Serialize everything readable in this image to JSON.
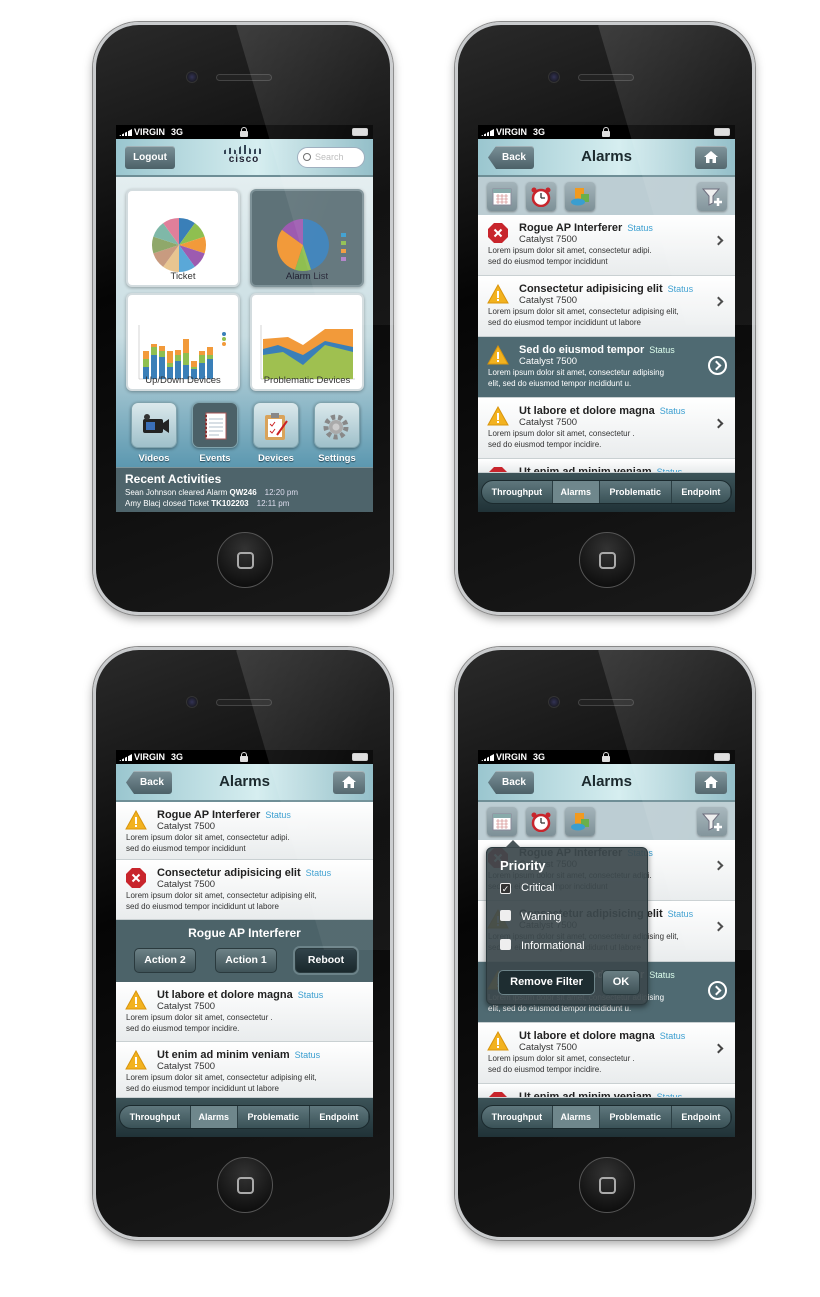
{
  "status_bar": {
    "carrier": "VIRGIN",
    "network": "3G"
  },
  "colors": {
    "accent": "#3a9ed0",
    "nav_dark": "#4e646b",
    "critical": "#c8252c",
    "warning": "#f2b21f"
  },
  "dashboard": {
    "logout_label": "Logout",
    "logo": "cisco",
    "search_placeholder": "Search",
    "tiles": [
      {
        "label": "Ticket",
        "icon": "pie-chart-thumbnail"
      },
      {
        "label": "Alarm List",
        "icon": "pie-chart-legend-thumbnail",
        "selected": true
      },
      {
        "label": "Up/Down Devices",
        "icon": "stacked-bar-chart-thumbnail"
      },
      {
        "label": "Problematic Devices",
        "icon": "area-chart-thumbnail"
      }
    ],
    "apps": [
      {
        "label": "Videos",
        "icon": "video-camera-icon"
      },
      {
        "label": "Events",
        "icon": "notebook-icon",
        "selected": true
      },
      {
        "label": "Devices",
        "icon": "clipboard-icon"
      },
      {
        "label": "Settings",
        "icon": "gear-icon"
      }
    ],
    "recent": {
      "title": "Recent Activities",
      "items": [
        {
          "text": "Sean Johnson cleared Alarm",
          "id": "QW246",
          "time": "12:20 pm"
        },
        {
          "text": "Amy Blacj closed Ticket",
          "id": "TK102203",
          "time": "12:11 pm"
        }
      ]
    }
  },
  "alarms_nav": {
    "back_label": "Back",
    "title": "Alarms",
    "home_icon": "home-icon"
  },
  "toolbar": {
    "icons": [
      "calendar-icon",
      "alarm-clock-icon",
      "devices-icon"
    ],
    "filter_icon": "filter-add-icon"
  },
  "alarm_list": [
    {
      "title": "Rogue AP Interferer",
      "status": "Status",
      "device": "Catalyst 7500",
      "desc": [
        "Lorem ipsum dolor sit amet, consectetur adipi.",
        "sed do eiusmod tempor incididunt"
      ],
      "severity": "critical"
    },
    {
      "title": "Consectetur adipisicing elit",
      "status": "Status",
      "device": "Catalyst 7500",
      "desc": [
        "Lorem ipsum dolor sit amet, consectetur adipising elit,",
        "sed do eiusmod tempor incididunt ut labore"
      ],
      "severity": "warning"
    },
    {
      "title": "Sed do eiusmod tempor",
      "status": "Status",
      "device": "Catalyst 7500",
      "desc": [
        "Lorem ipsum dolor sit amet, consectetur adipising",
        "elit, sed do eiusmod tempor incididunt u."
      ],
      "severity": "warning",
      "selected": true
    },
    {
      "title": "Ut labore et dolore magna",
      "status": "Status",
      "device": "Catalyst 7500",
      "desc": [
        "Lorem ipsum dolor sit amet, consectetur .",
        "sed do eiusmod tempor incidire."
      ],
      "severity": "warning"
    },
    {
      "title": "Ut enim ad minim veniam",
      "status": "Status",
      "device": "",
      "desc": [
        "",
        ""
      ],
      "severity": "critical"
    }
  ],
  "action_list": [
    {
      "title": "Rogue AP Interferer",
      "status": "Status",
      "device": "Catalyst 7500",
      "desc": [
        "Lorem ipsum dolor sit amet, consectetur adipi.",
        "sed do eiusmod tempor incididunt"
      ],
      "severity": "warning"
    },
    {
      "title": "Consectetur adipisicing elit",
      "status": "Status",
      "device": "Catalyst 7500",
      "desc": [
        "Lorem ipsum dolor sit amet, consectetur adipising elit,",
        "sed do eiusmod tempor incididunt ut labore"
      ],
      "severity": "critical"
    },
    {
      "title": "Ut labore et dolore magna",
      "status": "Status",
      "device": "Catalyst 7500",
      "desc": [
        "Lorem ipsum dolor sit amet, consectetur .",
        "sed do eiusmod tempor incidire."
      ],
      "severity": "warning"
    },
    {
      "title": "Ut enim ad minim veniam",
      "status": "Status",
      "device": "Catalyst 7500",
      "desc": [
        "Lorem ipsum dolor sit amet, consectetur adipising elit,",
        "sed do eiusmod tempor incididunt ut labore"
      ],
      "severity": "warning"
    }
  ],
  "action_panel": {
    "title": "Rogue AP Interferer",
    "buttons": [
      "Action 2",
      "Action 1",
      "Reboot"
    ]
  },
  "filter_popup": {
    "title": "Priority",
    "options": [
      {
        "label": "Critical",
        "checked": true
      },
      {
        "label": "Warning",
        "checked": false
      },
      {
        "label": "Informational",
        "checked": false
      }
    ],
    "remove_label": "Remove Filter",
    "ok_label": "OK"
  },
  "tabs": [
    {
      "label": "Throughput"
    },
    {
      "label": "Alarms",
      "active": true
    },
    {
      "label": "Problematic"
    },
    {
      "label": "Endpoint"
    }
  ]
}
